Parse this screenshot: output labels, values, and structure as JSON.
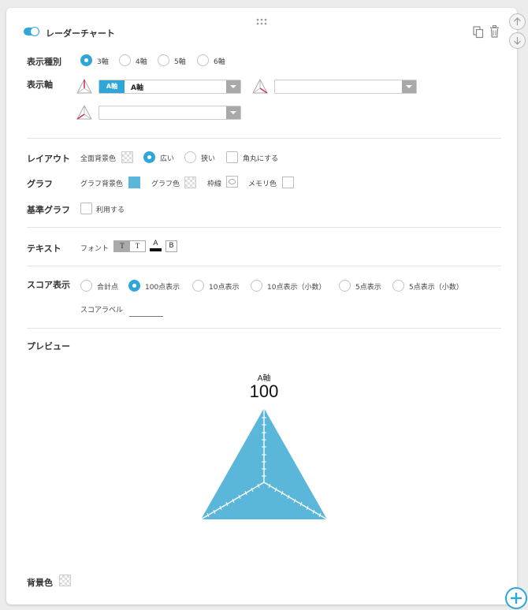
{
  "header": {
    "title": "レーダーチャート",
    "enabled": true
  },
  "display_type": {
    "label": "表示種別",
    "options": [
      "3軸",
      "4軸",
      "5軸",
      "6軸"
    ],
    "selected": "3軸"
  },
  "display_axes": {
    "label": "表示軸",
    "axes": [
      {
        "tag": "A軸",
        "value": "A軸"
      },
      {
        "tag": "",
        "value": ""
      },
      {
        "tag": "",
        "value": ""
      }
    ]
  },
  "layout": {
    "label": "レイアウト",
    "bg_label": "全面背景色",
    "options": [
      "広い",
      "狭い"
    ],
    "selected": "広い",
    "rounded_label": "角丸にする"
  },
  "graph": {
    "label": "グラフ",
    "bg_label": "グラフ背景色",
    "bg_color": "#5bb7d9",
    "color_label": "グラフ色",
    "border_label": "枠線",
    "tick_label": "メモリ色"
  },
  "base_graph": {
    "label": "基準グラフ",
    "use_label": "利用する"
  },
  "text": {
    "label": "テキスト",
    "font_label": "フォント",
    "font_btn_1": "T",
    "font_btn_2": "T",
    "color_btn": "A",
    "bold_btn": "B"
  },
  "score": {
    "label": "スコア表示",
    "options": [
      "合計点",
      "100点表示",
      "10点表示",
      "10点表示（小数）",
      "5点表示",
      "5点表示（小数）"
    ],
    "selected": "100点表示",
    "score_label_text": "スコアラベル"
  },
  "preview": {
    "label": "プレビュー",
    "axis_name": "A軸",
    "score": "100"
  },
  "background": {
    "label": "背景色"
  },
  "colors": {
    "accent": "#2ea7d8",
    "radar_fill": "#5bb7d9",
    "icon_red": "#d0306a"
  },
  "icons": [
    "drag-handle-icon",
    "copy-icon",
    "trash-icon",
    "arrow-up-icon",
    "arrow-down-icon",
    "add-icon",
    "axis-triangle-icon"
  ]
}
